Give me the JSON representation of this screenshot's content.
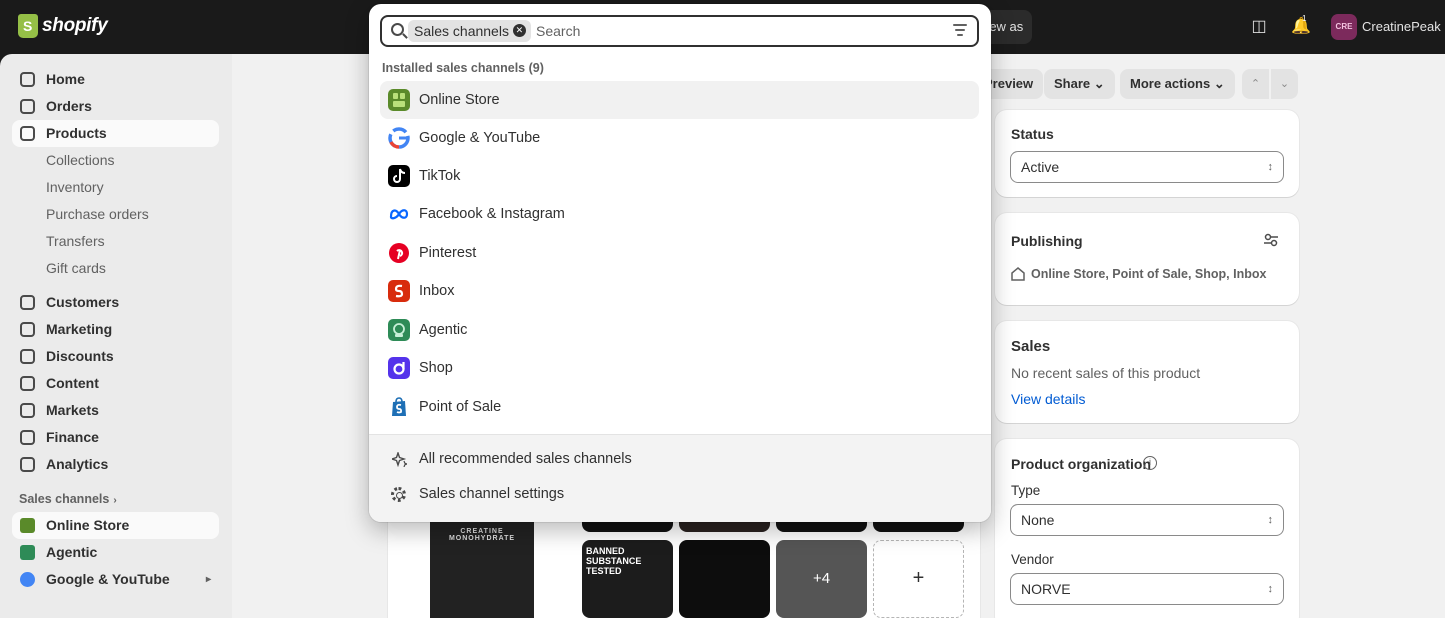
{
  "topbar": {
    "logo": "shopify",
    "view_as": "View as",
    "notification_count": "1",
    "avatar_initials": "CRE",
    "store_name": "CreatinePeak"
  },
  "sidebar": {
    "items": [
      {
        "label": "Home"
      },
      {
        "label": "Orders"
      },
      {
        "label": "Products"
      },
      {
        "label": "Collections"
      },
      {
        "label": "Inventory"
      },
      {
        "label": "Purchase orders"
      },
      {
        "label": "Transfers"
      },
      {
        "label": "Gift cards"
      },
      {
        "label": "Customers"
      },
      {
        "label": "Marketing"
      },
      {
        "label": "Discounts"
      },
      {
        "label": "Content"
      },
      {
        "label": "Markets"
      },
      {
        "label": "Finance"
      },
      {
        "label": "Analytics"
      }
    ],
    "sales_channels_label": "Sales channels",
    "channels": [
      {
        "label": "Online Store"
      },
      {
        "label": "Agentic"
      },
      {
        "label": "Google & YouTube"
      }
    ]
  },
  "page_actions": {
    "preview": "Preview",
    "share": "Share",
    "more_actions": "More actions"
  },
  "status_card": {
    "title": "Status",
    "value": "Active"
  },
  "publishing_card": {
    "title": "Publishing",
    "channels": "Online Store, Point of Sale, Shop, Inbox"
  },
  "sales_card": {
    "title": "Sales",
    "text": "No recent sales of this product",
    "link": "View details"
  },
  "organization_card": {
    "title": "Product organization",
    "type_label": "Type",
    "type_value": "None",
    "vendor_label": "Vendor",
    "vendor_value": "NORVE"
  },
  "media": {
    "more_count": "+4",
    "jar_text": "CREATINE MONOHYDRATE",
    "thumb_text": "BANNED SUBSTANCE TESTED"
  },
  "popover": {
    "search": {
      "tag": "Sales channels",
      "placeholder": "Search"
    },
    "group_label": "Installed sales channels (9)",
    "channels": [
      {
        "label": "Online Store",
        "color": "#5a8a2a"
      },
      {
        "label": "Google & YouTube",
        "color": "#4285f4"
      },
      {
        "label": "TikTok",
        "color": "#000000"
      },
      {
        "label": "Facebook & Instagram",
        "color": "#0866ff"
      },
      {
        "label": "Pinterest",
        "color": "#e60023"
      },
      {
        "label": "Inbox",
        "color": "#d82c0d"
      },
      {
        "label": "Agentic",
        "color": "#2e8b57"
      },
      {
        "label": "Shop",
        "color": "#5433eb"
      },
      {
        "label": "Point of Sale",
        "color": "#1e6fb5"
      }
    ],
    "footer": {
      "all_recommended": "All recommended sales channels",
      "settings": "Sales channel settings"
    }
  }
}
